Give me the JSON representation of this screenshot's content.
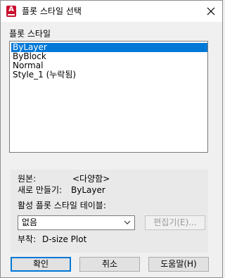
{
  "window": {
    "title": "플롯 스타일 선택",
    "app_icon_letter": "A"
  },
  "plot_styles": {
    "label": "플롯 스타일",
    "items": [
      "ByLayer",
      "ByBlock",
      "Normal",
      "Style_1 (누락됨)"
    ],
    "selected_index": 0
  },
  "info": {
    "original_label": "원본:",
    "original_value": "<다양함>",
    "new_label": "새로 만들기:",
    "new_value": "ByLayer",
    "active_table_label": "활성 플롯 스타일 테이블:",
    "active_table_value": "없음",
    "edit_button": "편집기(E)...",
    "attached_label": "부착:",
    "attached_value": "D-size Plot"
  },
  "buttons": {
    "ok": "확인",
    "cancel": "취소",
    "help": "도움말(H)"
  },
  "colors": {
    "selection": "#0078d7",
    "app_icon": "#c8102e"
  }
}
